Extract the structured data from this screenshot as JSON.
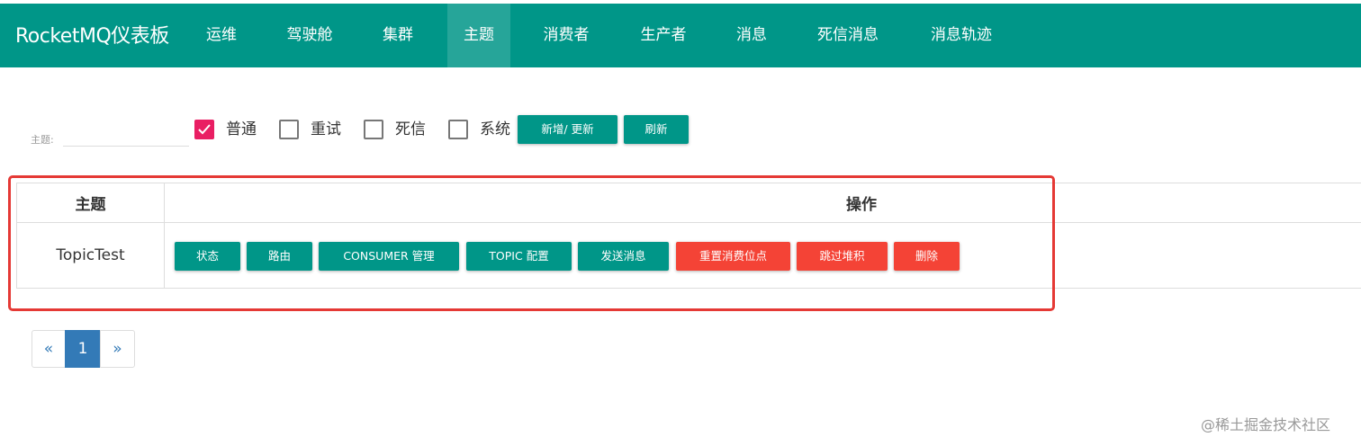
{
  "header": {
    "brand": "RocketMQ仪表板",
    "nav": [
      "运维",
      "驾驶舱",
      "集群",
      "主题",
      "消费者",
      "生产者",
      "消息",
      "死信消息",
      "消息轨迹"
    ],
    "active_nav": "主题",
    "color": "#009688"
  },
  "filter": {
    "topic_label": "主题:",
    "topic_value": "",
    "checkboxes": [
      {
        "label": "普通",
        "checked": true
      },
      {
        "label": "重试",
        "checked": false
      },
      {
        "label": "死信",
        "checked": false
      },
      {
        "label": "系统",
        "checked": false
      }
    ],
    "add_update_button": "新增/ 更新",
    "refresh_button": "刷新"
  },
  "table": {
    "columns": [
      "主题",
      "操作"
    ],
    "rows": [
      {
        "topic": "TopicTest",
        "actions": [
          "状态",
          "路由",
          "CONSUMER 管理",
          "TOPIC 配置",
          "发送消息",
          "重置消费位点",
          "跳过堆积",
          "删除"
        ]
      }
    ]
  },
  "pagination": {
    "prev": "«",
    "current": "1",
    "next": "»"
  },
  "colors": {
    "primary": "#009688",
    "danger": "#f44336",
    "checkbox_checked": "#e91e63",
    "highlight": "#e53935",
    "page_active": "#337ab7"
  },
  "watermark": "@稀土掘金技术社区"
}
